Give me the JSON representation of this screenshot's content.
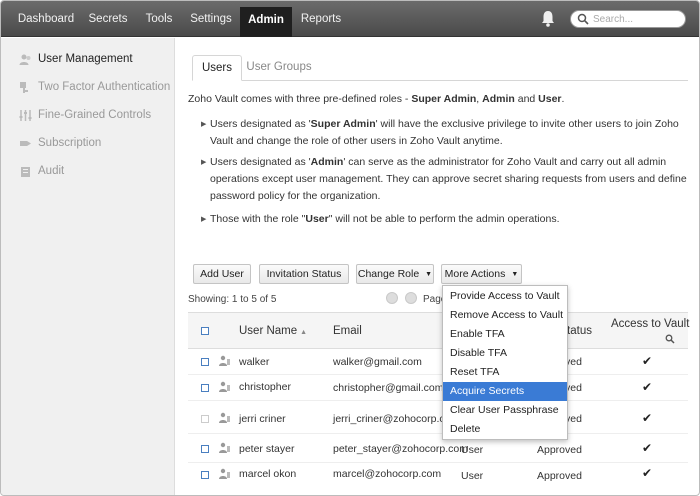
{
  "nav": {
    "items": [
      "Dashboard",
      "Secrets",
      "Tools",
      "Settings",
      "Admin",
      "Reports"
    ],
    "active": "Admin",
    "search_placeholder": "Search..."
  },
  "sidebar": {
    "items": [
      {
        "label": "User Management",
        "icon": "users-icon"
      },
      {
        "label": "Two Factor Authentication",
        "icon": "key-icon"
      },
      {
        "label": "Fine-Grained Controls",
        "icon": "sliders-icon"
      },
      {
        "label": "Subscription",
        "icon": "tag-icon"
      },
      {
        "label": "Audit",
        "icon": "clipboard-icon"
      }
    ]
  },
  "tabs": [
    "Users",
    "User Groups"
  ],
  "intro": {
    "before": "Zoho Vault comes with three pre-defined roles - ",
    "role1": "Super Admin",
    "sep1": ", ",
    "role2": "Admin",
    "sep2": " and ",
    "role3": "User",
    "after": "."
  },
  "bullets": [
    {
      "before": "Users designated as '",
      "role": "Super Admin",
      "after": "' will have the exclusive privilege to invite other users to join Zoho Vault and change the role of other users in Zoho Vault anytime."
    },
    {
      "before": "Users designated as '",
      "role": "Admin",
      "after": "' can serve as the administrator for Zoho Vault and carry out all admin operations except user management. They can approve secret sharing requests from users and define password policy for the organization."
    },
    {
      "before": "Those with the role \"",
      "role": "User",
      "after": "\" will not be able to perform the admin operations."
    }
  ],
  "actions": {
    "add_user": "Add User",
    "invitation_status": "Invitation Status",
    "change_role": "Change Role",
    "more_actions": "More Actions"
  },
  "paging": {
    "showing": "Showing: 1 to 5 of 5",
    "page_label": "Page"
  },
  "table": {
    "headers": {
      "user_name": "User Name",
      "email": "Email",
      "status": "Status",
      "access": "Access to Vault"
    },
    "rows": [
      {
        "name": "walker",
        "email": "walker@gmail.com",
        "role": "",
        "status": "Approved",
        "access": "✔"
      },
      {
        "name": "christopher",
        "email": "christopher@gmail.com",
        "role": "",
        "status": "Approved",
        "access": "✔"
      },
      {
        "name": "jerri criner",
        "email": "jerri_criner@zohocorp.com",
        "role": "",
        "status": "Approved",
        "access": "✔"
      },
      {
        "name": "peter stayer",
        "email": "peter_stayer@zohocorp.com",
        "role": "User",
        "status": "Approved",
        "access": "✔"
      },
      {
        "name": "marcel okon",
        "email": "marcel@zohocorp.com",
        "role": "User",
        "status": "Approved",
        "access": "✔"
      }
    ]
  },
  "more_actions_menu": {
    "items": [
      "Provide Access to Vault",
      "Remove Access to Vault",
      "Enable TFA",
      "Disable TFA",
      "Reset TFA",
      "Acquire Secrets",
      "Clear User Passphrase",
      "Delete"
    ],
    "highlighted": "Acquire Secrets"
  },
  "colors": {
    "nav_bg": "#555555",
    "nav_active": "#1f1f1f",
    "menu_highlight": "#3a7bd5",
    "checkbox": "#4a7fc0"
  }
}
